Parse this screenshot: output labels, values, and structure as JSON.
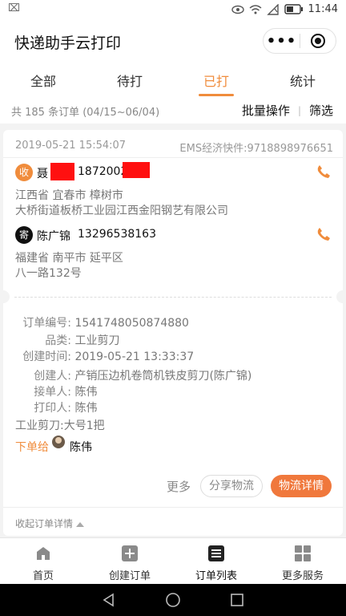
{
  "status_bar": {
    "time": "11:44",
    "notification": "⌧"
  },
  "app": {
    "title": "快递助手云打印",
    "more_label": "•••"
  },
  "tabs": [
    {
      "label": "全部",
      "active": false
    },
    {
      "label": "待打",
      "active": false
    },
    {
      "label": "已打",
      "active": true
    },
    {
      "label": "统计",
      "active": false
    }
  ],
  "summary": {
    "count_text": "共 185 条订单 (04/15~06/04)",
    "batch_label": "批量操作",
    "divider": "|",
    "filter_label": "筛选"
  },
  "order": {
    "date": "2019-05-21 15:54:07",
    "tracking": "EMS经济快件:9718898976651",
    "sender": {
      "badge": "收",
      "name": "聂",
      "phone": "18720028",
      "addr_line1": "江西省 宜春市 樟树市",
      "addr_line2": "大桥街道板桥工业园江西金阳钢艺有限公司"
    },
    "receiver": {
      "badge": "寄",
      "name": "陈广锦",
      "phone": "13296538163",
      "addr_line1": "福建省 南平市 延平区",
      "addr_line2": "八一路132号"
    },
    "details": {
      "order_no_label": "订单编号:",
      "order_no": "1541748050874880",
      "category_label": "品类:",
      "category": "工业剪刀",
      "created_label": "创建时间:",
      "created": "2019-05-21 13:33:37",
      "creator_label": "创建人:",
      "creator": "产销压边机卷筒机铁皮剪刀(陈广锦)",
      "taker_label": "接单人:",
      "taker": "陈伟",
      "printer_label": "打印人:",
      "printer": "陈伟",
      "goods": "工业剪刀:大号1把"
    },
    "assign_label": "下单给",
    "assign_to": "陈伟",
    "more_label": "更多",
    "share_label": "分享物流",
    "logistics_label": "物流详情",
    "collapse_label": "收起订单详情"
  },
  "bottom_nav": [
    {
      "label": "首页",
      "icon": "home-icon"
    },
    {
      "label": "创建订单",
      "icon": "plus-icon"
    },
    {
      "label": "订单列表",
      "icon": "list-icon"
    },
    {
      "label": "更多服务",
      "icon": "grid-icon"
    }
  ],
  "colors": {
    "accent": "#f08c3c",
    "button": "#f0783c",
    "redaction": "#ff1010"
  }
}
